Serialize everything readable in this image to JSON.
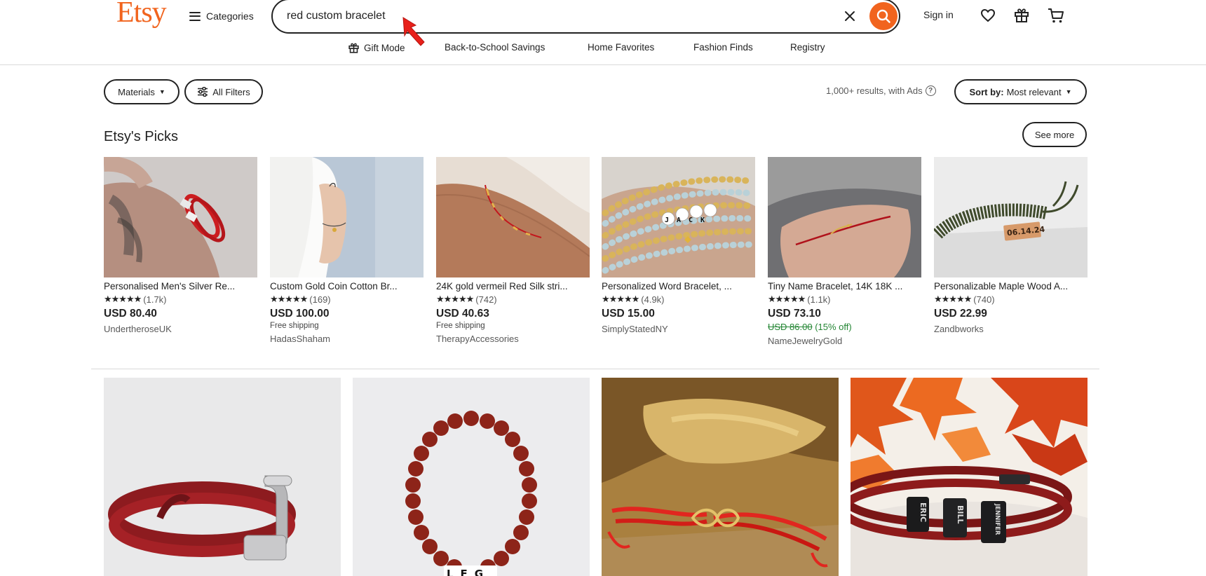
{
  "header": {
    "logo": "Etsy",
    "categories_label": "Categories",
    "search_value": "red custom bracelet",
    "signin_label": "Sign in"
  },
  "subnav": [
    {
      "label": "Gift Mode"
    },
    {
      "label": "Back-to-School Savings"
    },
    {
      "label": "Home Favorites"
    },
    {
      "label": "Fashion Finds"
    },
    {
      "label": "Registry"
    }
  ],
  "filters": {
    "materials_label": "Materials",
    "all_filters_label": "All Filters",
    "results_text": "1,000+ results, with Ads",
    "sort_prefix": "Sort by:",
    "sort_value": "Most relevant"
  },
  "picks": {
    "title": "Etsy's Picks",
    "see_more": "See more",
    "items": [
      {
        "title": "Personalised Men's Silver Re...",
        "stars": "★★★★★",
        "reviews": "(1.7k)",
        "price": "USD 80.40",
        "shipping": "",
        "original_price": "",
        "discount": "",
        "shop": "UndertheroseUK"
      },
      {
        "title": "Custom Gold Coin Cotton Br...",
        "stars": "★★★★★",
        "reviews": "(169)",
        "price": "USD 100.00",
        "shipping": "Free shipping",
        "original_price": "",
        "discount": "",
        "shop": "HadasShaham"
      },
      {
        "title": "24K gold vermeil Red Silk stri...",
        "stars": "★★★★★",
        "reviews": "(742)",
        "price": "USD 40.63",
        "shipping": "Free shipping",
        "original_price": "",
        "discount": "",
        "shop": "TherapyAccessories"
      },
      {
        "title": "Personalized Word Bracelet, ...",
        "stars": "★★★★★",
        "reviews": "(4.9k)",
        "price": "USD 15.00",
        "shipping": "",
        "original_price": "",
        "discount": "",
        "shop": "SimplyStatedNY"
      },
      {
        "title": "Tiny Name Bracelet, 14K 18K ...",
        "stars": "★★★★★",
        "reviews": "(1.1k)",
        "price": "USD 73.10",
        "shipping": "",
        "original_price": "USD 86.00",
        "discount": "(15% off)",
        "shop": "NameJewelryGold"
      },
      {
        "title": "Personalizable Maple Wood A...",
        "stars": "★★★★★",
        "reviews": "(740)",
        "price": "USD 22.99",
        "shipping": "",
        "original_price": "",
        "discount": "",
        "shop": "Zandbworks"
      }
    ]
  },
  "image_text": {
    "pick4_beads": "JACK",
    "pick6_tag": "06.14.24",
    "grid2_beads": "LFG",
    "grid4_beads": [
      "ERIC",
      "BILL",
      "JENNIFER"
    ]
  },
  "colors": {
    "brand": "#f1641e",
    "discount_green": "#258635",
    "text": "#222222"
  }
}
